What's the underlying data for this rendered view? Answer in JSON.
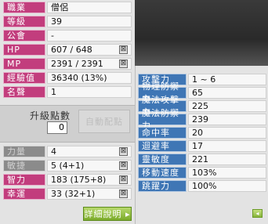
{
  "basic": {
    "job": {
      "label": "職業",
      "value": "僧侶"
    },
    "level": {
      "label": "等級",
      "value": "39"
    },
    "guild": {
      "label": "公會",
      "value": "-"
    },
    "hp": {
      "label": "HP",
      "value": "607 / 648"
    },
    "mp": {
      "label": "MP",
      "value": "2391 / 2391"
    },
    "exp": {
      "label": "經驗值",
      "value": "36340 (13%)"
    },
    "fame": {
      "label": "名聲",
      "value": "1"
    }
  },
  "ability_points": {
    "label": "升級點數",
    "value": "0",
    "auto_assign_label": "自動配點"
  },
  "stats": {
    "str": {
      "label": "力量",
      "value": "4"
    },
    "dex": {
      "label": "敏捷",
      "value": "5 (4+1)"
    },
    "int": {
      "label": "智力",
      "value": "183 (175+8)"
    },
    "luk": {
      "label": "幸運",
      "value": "33 (32+1)"
    }
  },
  "detail_button_label": "詳細說明 ▸",
  "detail": {
    "attack": {
      "label": "攻擊力",
      "value": "1 ~ 6"
    },
    "wdef": {
      "label": "物理防禦力",
      "value": "65"
    },
    "matk": {
      "label": "魔法攻擊力",
      "value": "225"
    },
    "mdef": {
      "label": "魔法防禦力",
      "value": "239"
    },
    "accuracy": {
      "label": "命中率",
      "value": "20"
    },
    "avoid": {
      "label": "迴避率",
      "value": "17"
    },
    "hands": {
      "label": "靈敏度",
      "value": "221"
    },
    "speed": {
      "label": "移動速度",
      "value": "103%"
    },
    "jump": {
      "label": "跳躍力",
      "value": "100%"
    }
  },
  "icons": {
    "minus": "⊠",
    "collapse": "◂"
  }
}
